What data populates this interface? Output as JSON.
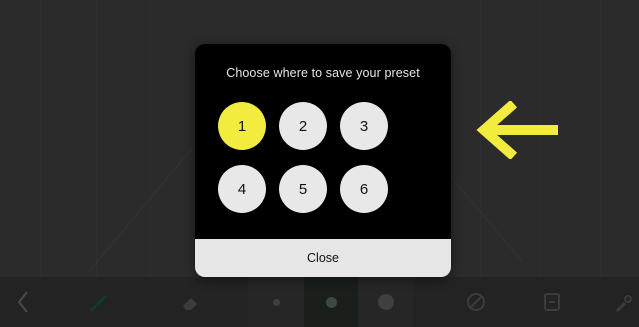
{
  "dialog": {
    "title": "Choose where to save your preset",
    "slots": [
      "1",
      "2",
      "3",
      "4",
      "5",
      "6"
    ],
    "selected_slot": "1",
    "close_label": "Close"
  },
  "colors": {
    "accent_yellow": "#f2ec3e",
    "dialog_bg": "#000000",
    "button_bg": "#e8e8e8",
    "toolbar_bg": "#232323"
  },
  "toolbar": {
    "icons": [
      "back-icon",
      "brush-icon",
      "eraser-icon",
      "size-small-icon",
      "size-medium-icon",
      "size-large-icon",
      "disable-icon",
      "save-icon",
      "tools-icon"
    ]
  }
}
